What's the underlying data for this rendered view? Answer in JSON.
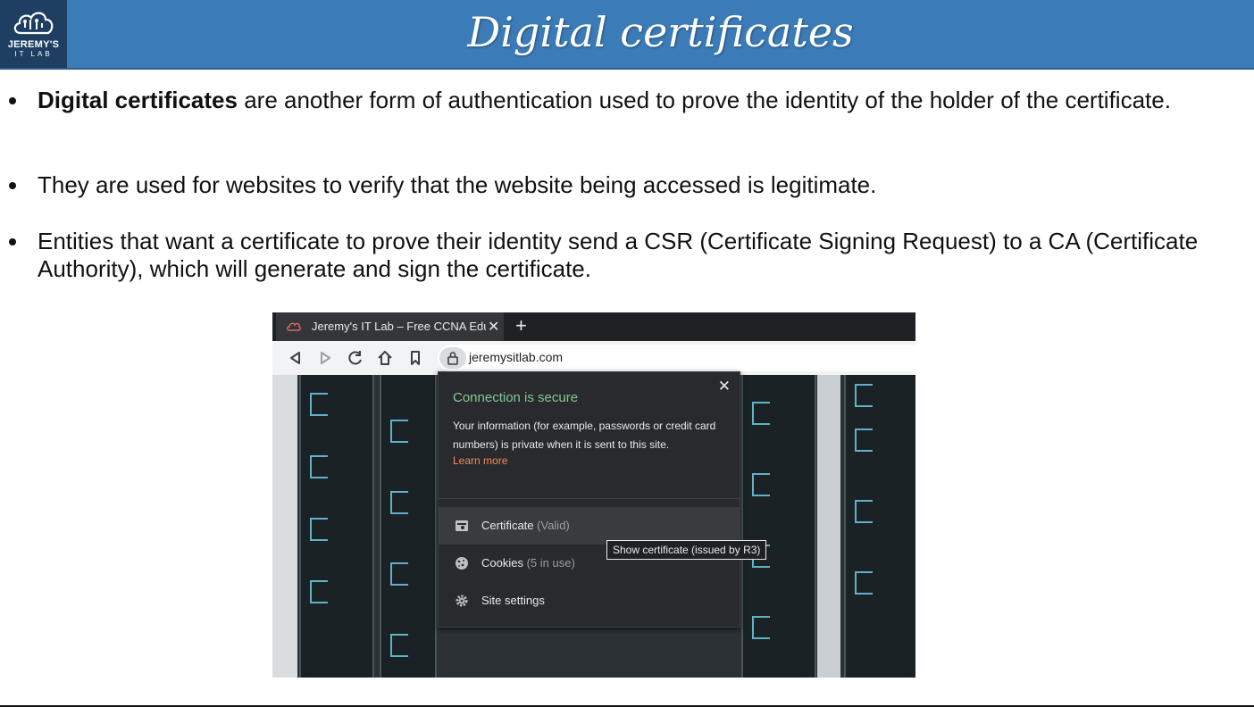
{
  "slide": {
    "title": "Digital certificates",
    "logo": {
      "line1": "JEREMY'S",
      "line2": "IT LAB"
    }
  },
  "bullets": [
    {
      "bold": "Digital certificates",
      "text": " are another form of authentication used to prove the identity of the holder of the certificate."
    },
    {
      "bold": "",
      "text": "They are used for websites to verify that the website being accessed is legitimate."
    },
    {
      "bold": "",
      "text": "Entities that want a certificate to prove their identity send a CSR (Certificate Signing Request) to a CA (Certificate Authority), which will generate and sign the certificate."
    }
  ],
  "browser": {
    "tab_title": "Jeremy's IT Lab – Free CCNA Educ",
    "tab_close": "✕",
    "new_tab": "+",
    "url": "jeremysitlab.com",
    "icons": [
      "back-icon",
      "forward-icon",
      "reload-icon",
      "home-icon",
      "bookmark-icon",
      "lock-icon"
    ]
  },
  "popup": {
    "close": "✕",
    "title": "Connection is secure",
    "description": "Your information (for example, passwords or credit card numbers) is private when it is sent to this site.",
    "link": "Learn more",
    "items": [
      {
        "label": "Certificate",
        "sub": "(Valid)",
        "icon": "certificate-icon"
      },
      {
        "label": "Cookies",
        "sub": "(5 in use)",
        "icon": "cookie-icon"
      },
      {
        "label": "Site settings",
        "sub": "",
        "icon": "gear-icon"
      }
    ],
    "tooltip": "Show certificate (issued by R3)"
  },
  "colors": {
    "header": "#3b7bb8",
    "secure_green": "#81c995",
    "link_orange": "#f28b5b"
  }
}
